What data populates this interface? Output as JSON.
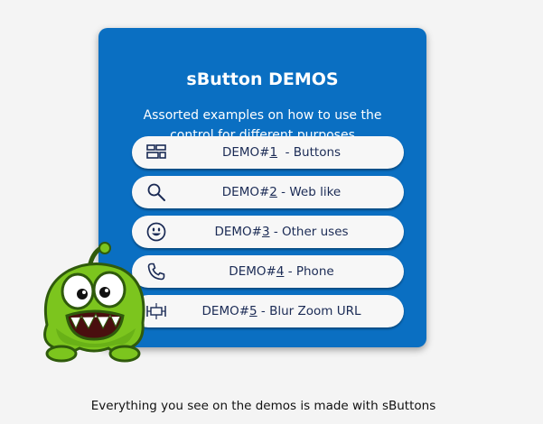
{
  "panel": {
    "title": "sButton DEMOS",
    "subtitle": "Assorted examples on how to use the control for different purposes"
  },
  "demos": [
    {
      "prefix": "DEMO#",
      "key": "1",
      "suffix": "  - Buttons",
      "icon": "layout-grid-icon"
    },
    {
      "prefix": "DEMO#",
      "key": "2",
      "suffix": " - Web like",
      "icon": "search-icon"
    },
    {
      "prefix": "DEMO#",
      "key": "3",
      "suffix": " - Other uses",
      "icon": "smiley-icon"
    },
    {
      "prefix": "DEMO#",
      "key": "4",
      "suffix": " - Phone",
      "icon": "phone-icon"
    },
    {
      "prefix": "DEMO#",
      "key": "5",
      "suffix": " - Blur Zoom URL",
      "icon": "zoom-frame-icon"
    }
  ],
  "footer": "Everything you see on the demos is made with sButtons",
  "colors": {
    "panel": "#0a6fc2",
    "button": "#f7f7f7",
    "button_text": "#1b2b55",
    "mascot_green": "#7cc51e"
  }
}
